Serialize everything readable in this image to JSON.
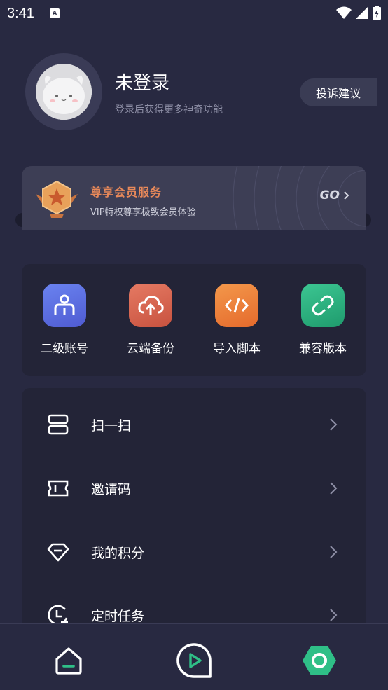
{
  "status": {
    "time": "3:41",
    "notification_letter": "A"
  },
  "profile": {
    "username": "未登录",
    "subtitle": "登录后获得更多神奇功能",
    "complaint_button": "投诉建议"
  },
  "vip": {
    "title": "尊享会员服务",
    "subtitle": "VIP特权尊享极致会员体验",
    "go_label": "GO",
    "accent_color": "#e8895a"
  },
  "tools": [
    {
      "label": "二级账号",
      "icon": "sub-account-icon",
      "color": "#5b6ee0"
    },
    {
      "label": "云端备份",
      "icon": "cloud-upload-icon",
      "color": "#d4614f"
    },
    {
      "label": "导入脚本",
      "icon": "code-icon",
      "color": "#ea7b3a"
    },
    {
      "label": "兼容版本",
      "icon": "link-icon",
      "color": "#2daa7c"
    }
  ],
  "menu": [
    {
      "label": "扫一扫",
      "icon": "scan-icon"
    },
    {
      "label": "邀请码",
      "icon": "ticket-icon"
    },
    {
      "label": "我的积分",
      "icon": "diamond-icon"
    },
    {
      "label": "定时任务",
      "icon": "clock-icon"
    }
  ],
  "tabs": [
    {
      "name": "home",
      "icon": "home-icon"
    },
    {
      "name": "play",
      "icon": "play-icon"
    },
    {
      "name": "settings",
      "icon": "hexagon-settings-icon",
      "active": true
    }
  ]
}
